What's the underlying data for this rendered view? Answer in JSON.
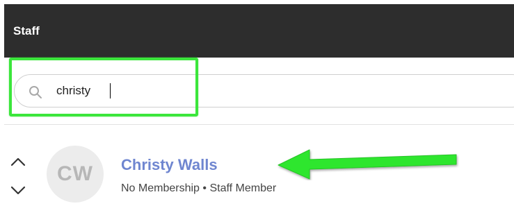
{
  "header": {
    "title": "Staff"
  },
  "search": {
    "value": "christy",
    "icon": "search-icon"
  },
  "staff_list": [
    {
      "initials": "CW",
      "name": "Christy Walls",
      "membership": "No Membership",
      "separator": "•",
      "role": "Staff Member"
    }
  ],
  "annotations": {
    "highlight_color": "#3be63b",
    "arrow_color": "#3be63b"
  },
  "colors": {
    "header_bg": "#2d2d2d",
    "name_link": "#6f86d0"
  }
}
